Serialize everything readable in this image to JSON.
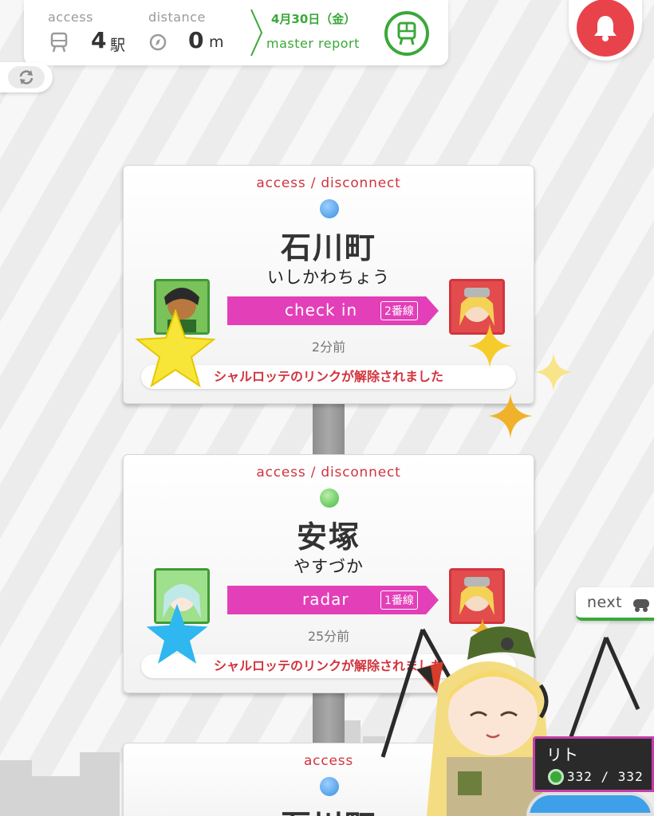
{
  "topbar": {
    "access_label": "access",
    "access_value": "4",
    "access_unit": "駅",
    "distance_label": "distance",
    "distance_value": "0",
    "distance_unit": "m",
    "date": "4月30日（金）",
    "report_label": "master report",
    "accent_color": "#3aa83a"
  },
  "cards": [
    {
      "status": "access / disconnect",
      "dot_color": "#3b8fe0",
      "name": "石川町",
      "kana": "いしかわちょう",
      "action": "check in",
      "track": "2番線",
      "time": "2分前",
      "message": "シャルロッテのリンクが解除されました"
    },
    {
      "status": "access / disconnect",
      "dot_color": "#45b847",
      "name": "安塚",
      "kana": "やすづか",
      "action": "radar",
      "track": "1番線",
      "time": "25分前",
      "message": "シャルロッテのリンクが解除されました"
    },
    {
      "status": "access",
      "dot_color": "#3b8fe0",
      "name": "石川町"
    }
  ],
  "next_label": "next",
  "character": {
    "name": "リト",
    "hp": "332 / 332"
  },
  "colors": {
    "status_red": "#d2343d",
    "action_pink": "#e33fb8",
    "bell_red": "#e8434b"
  }
}
